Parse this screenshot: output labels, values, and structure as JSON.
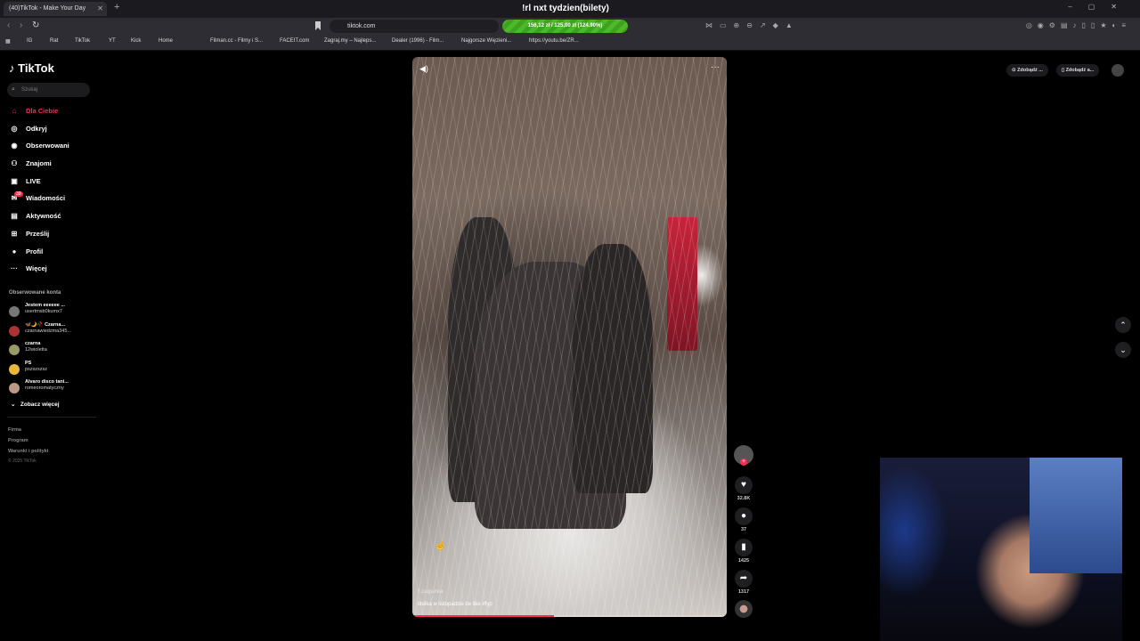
{
  "browser": {
    "tab_title": "(40)TikTok - Make Your Day",
    "stream_title": "!rl nxt tydzien(bilety)",
    "donation_bar": "156,12 zł / 125,00 zł (124.90%)",
    "url": "tiktok.com",
    "bookmarks": [
      "IG",
      "Rat",
      "TikTok",
      "YT",
      "Kick",
      "Home",
      "Filman.cc - Filmy i S...",
      "FACEIT.com",
      "Zagraj.my – Najleps...",
      "Dealer (1996) - Film...",
      "Najgorsze Więzieni...",
      "https://youtu.be/ZR..."
    ]
  },
  "tiktok": {
    "logo": "TikTok",
    "search_placeholder": "Szukaj",
    "nav": [
      {
        "label": "Dla Ciebie",
        "icon": "home-icon"
      },
      {
        "label": "Odkryj",
        "icon": "compass-icon"
      },
      {
        "label": "Obserwowani",
        "icon": "following-icon"
      },
      {
        "label": "Znajomi",
        "icon": "friends-icon"
      },
      {
        "label": "LIVE",
        "icon": "live-icon"
      },
      {
        "label": "Wiadomości",
        "icon": "messages-icon",
        "badge": "39"
      },
      {
        "label": "Aktywność",
        "icon": "activity-icon"
      },
      {
        "label": "Prześlij",
        "icon": "upload-icon"
      },
      {
        "label": "Profil",
        "icon": "profile-icon"
      },
      {
        "label": "Więcej",
        "icon": "more-icon"
      }
    ],
    "following_title": "Obserwowane konta",
    "following": [
      {
        "name": "Jestem eeeeee ...",
        "handle": "usertmsb0kumx7"
      },
      {
        "name": "🦋🌙🥀 Czarna...",
        "handle": "czarnawiedzma345..."
      },
      {
        "name": "czarna",
        "handle": "12wioletta"
      },
      {
        "name": "PS",
        "handle": "pszszszsz"
      },
      {
        "name": "Alvaro disco tani...",
        "handle": "romeoromatyczny"
      }
    ],
    "see_more": "Zobacz więcej",
    "footer": [
      "Firma",
      "Program",
      "Warunki i polityki"
    ],
    "copyright": "© 2025 TikTok",
    "get_app": [
      "Zdobądź ...",
      "Zdobądź a..."
    ]
  },
  "video": {
    "author": "f.zagurka",
    "caption": "titelka w listopadzie be like #fyp",
    "progress": 0.45
  },
  "actions": {
    "likes": "32.8K",
    "comments": "37",
    "saves": "1425",
    "shares": "1317"
  },
  "colors": {
    "accent": "#fe2c55",
    "background": "#000000"
  }
}
